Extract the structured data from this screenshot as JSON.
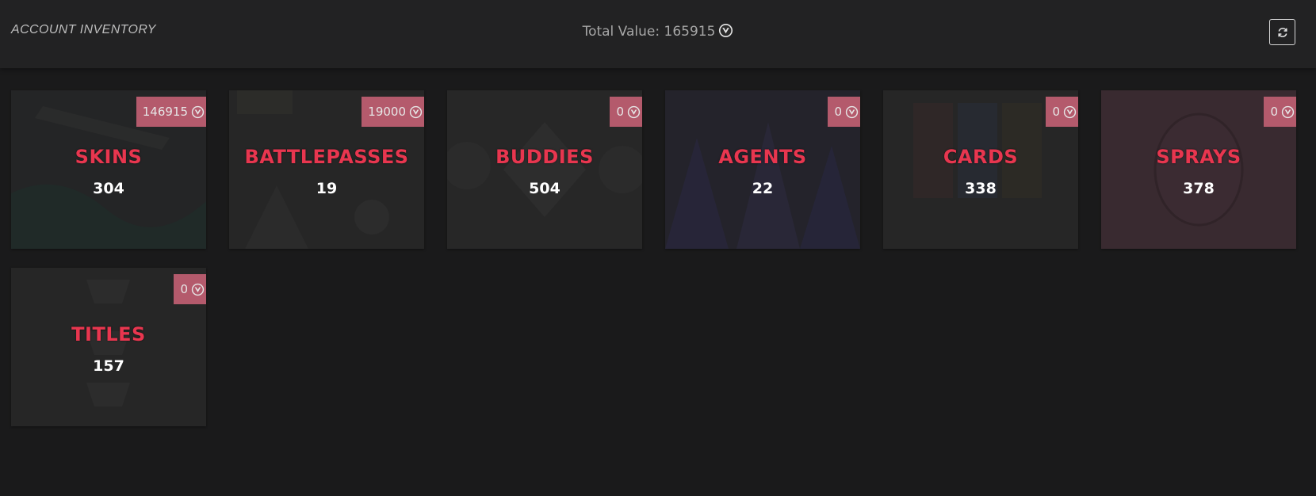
{
  "header": {
    "title": "ACCOUNT INVENTORY",
    "total_label": "Total Value: 165915",
    "currency_icon": "valorant-points-icon",
    "refresh_icon": "refresh-icon"
  },
  "accent_colors": {
    "title_red": "#e8364f",
    "badge_pink": "#b45a6c",
    "background": "#1a1a1b"
  },
  "categories": [
    {
      "title": "SKINS",
      "count": "304",
      "value": "146915"
    },
    {
      "title": "BATTLEPASSES",
      "count": "19",
      "value": "19000"
    },
    {
      "title": "BUDDIES",
      "count": "504",
      "value": "0"
    },
    {
      "title": "AGENTS",
      "count": "22",
      "value": "0"
    },
    {
      "title": "CARDS",
      "count": "338",
      "value": "0"
    },
    {
      "title": "SPRAYS",
      "count": "378",
      "value": "0"
    },
    {
      "title": "TITLES",
      "count": "157",
      "value": "0"
    }
  ]
}
